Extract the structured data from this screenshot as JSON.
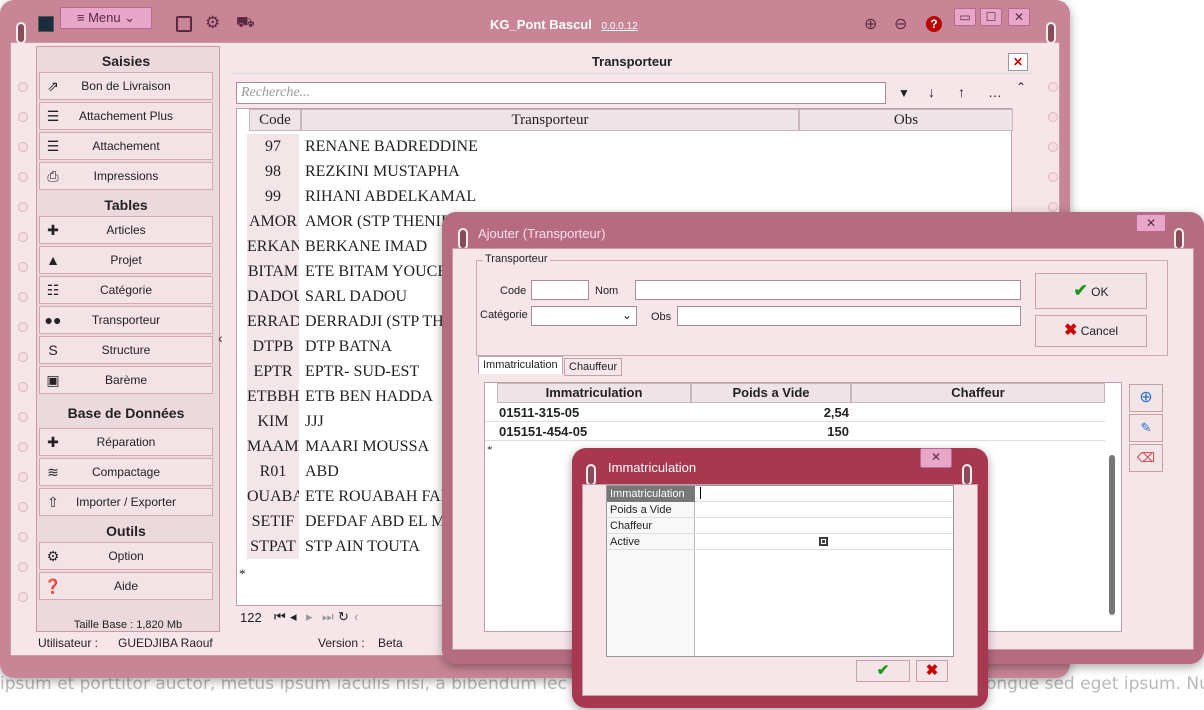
{
  "background_text": "ipsum et porttitor auctor, metus ipsum iaculis nisi, a bibendum lec",
  "background_text_right": "ongue sed eget ipsum. Nu",
  "main": {
    "app_title": "KG_Pont Bascul",
    "version_label": "0.0.0.12",
    "menu_label": "Menu",
    "min": "▭",
    "max": "☐",
    "close": "✕",
    "sidebar": {
      "saisies": "Saisies",
      "tables": "Tables",
      "base": "Base de Données",
      "outils": "Outils",
      "items": [
        "Bon de Livraison",
        "Attachement Plus",
        "Attachement",
        "Impressions",
        "Articles",
        "Projet",
        "Catégorie",
        "Transporteur",
        "Structure",
        "Barème",
        "Réparation",
        "Compactage",
        "Importer  / Exporter",
        "Option",
        "Aide"
      ],
      "size": "Taille Base : 1,820 Mb"
    },
    "panel_title": "Transporteur",
    "search_placeholder": "Recherche...",
    "headers": [
      "Code",
      "Transporteur",
      "Obs"
    ],
    "rows": [
      [
        "97",
        "RENANE BADREDDINE"
      ],
      [
        "98",
        "REZKINI MUSTAPHA"
      ],
      [
        "99",
        "RIHANI ABDELKAMAL"
      ],
      [
        "AMOR",
        "AMOR (STP THENIET"
      ],
      [
        "ERKAN",
        "BERKANE IMAD"
      ],
      [
        "BITAM",
        "ETE BITAM YOUCE"
      ],
      [
        "DADOU",
        "SARL DADOU"
      ],
      [
        "ERRAD",
        "DERRADJI (STP THE"
      ],
      [
        "DTPB",
        "DTP BATNA"
      ],
      [
        "EPTR",
        "EPTR- SUD-EST"
      ],
      [
        "ETBBH",
        "ETB BEN HADDA"
      ],
      [
        "KIM",
        "JJJ"
      ],
      [
        "MAAMR",
        "MAARI MOUSSA"
      ],
      [
        "R01",
        "ABD"
      ],
      [
        "OUABA",
        "ETE ROUABAH FAR"
      ],
      [
        "SETIF",
        "DEFDAF ABD EL M"
      ],
      [
        "STPAT",
        "STP AIN TOUTA"
      ]
    ],
    "new_row": "*",
    "count": "122",
    "status": {
      "user_label": "Utilisateur :",
      "user": "GUEDJIBA Raouf",
      "version_label": "Version :",
      "version": "Beta"
    }
  },
  "dialog": {
    "title": "Ajouter (Transporteur)",
    "group": "Transporteur",
    "code_label": "Code",
    "nom_label": "Nom",
    "cat_label": "Catégorie",
    "obs_label": "Obs",
    "ok": "OK",
    "cancel": "Cancel",
    "tabs": [
      "Immatriculation",
      "Chauffeur"
    ],
    "headers": [
      "Immatriculation",
      "Poids a Vide",
      "Chaffeur"
    ],
    "rows": [
      [
        "01511-315-05",
        "2,54",
        ""
      ],
      [
        "015151-454-05",
        "150",
        ""
      ]
    ],
    "new_row": "*"
  },
  "immat": {
    "title": "Immatriculation",
    "fields": [
      "Immatriculation",
      "Poids a Vide",
      "Chaffeur",
      "Active"
    ]
  }
}
